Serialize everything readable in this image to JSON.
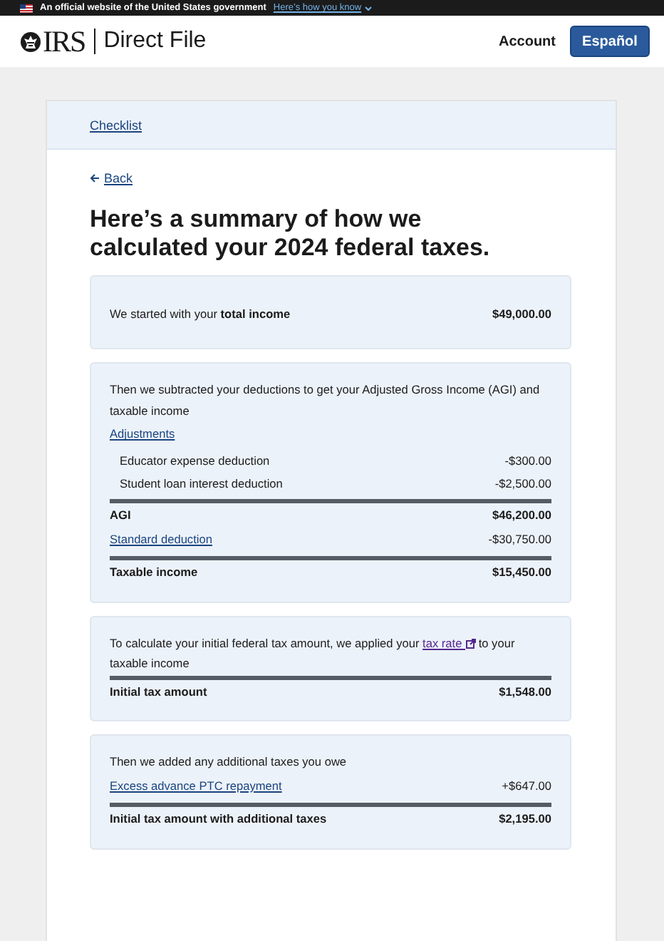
{
  "banner": {
    "text": "An official website of the United States government",
    "link": "Here’s how you know"
  },
  "header": {
    "logo": "IRS",
    "product": "Direct File",
    "nav": [
      "Account"
    ],
    "language_button": "Español"
  },
  "breadcrumb": "Checklist",
  "back_link": "Back",
  "heading": "Here’s a summary of how we calculated your 2024 federal taxes.",
  "sections": [
    {
      "rows": [
        {
          "kind": "summary",
          "label": "We started with your **total income**",
          "amount": "$49,000.00"
        }
      ]
    },
    {
      "rows": [
        {
          "kind": "text",
          "label": "Then we subtracted your deductions to get your Adjusted Gross Income (AGI) and taxable income"
        },
        {
          "kind": "link",
          "label": "Adjustments"
        },
        {
          "kind": "item",
          "label": "Educator expense deduction",
          "amount": "-$300.00"
        },
        {
          "kind": "item",
          "label": "Student loan interest deduction",
          "amount": "-$2,500.00"
        },
        {
          "kind": "total",
          "label": "AGI",
          "amount": "$46,200.00"
        },
        {
          "kind": "link",
          "label": "Standard deduction",
          "amount": "-$30,750.00"
        },
        {
          "kind": "total",
          "label": "Taxable income",
          "amount": "$15,450.00"
        }
      ]
    },
    {
      "rows": [
        {
          "kind": "text",
          "label": "To calculate your initial federal tax amount, we applied your",
          "link": "tax rate",
          "after": "to your taxable income"
        },
        {
          "kind": "total",
          "label": "Initial tax amount",
          "amount": "$1,548.00"
        }
      ]
    },
    {
      "rows": [
        {
          "kind": "text",
          "label": "Then we added any additional taxes you owe"
        },
        {
          "kind": "link",
          "label": "Excess advance PTC repayment",
          "amount": "+$647.00"
        },
        {
          "kind": "total",
          "label": "Initial tax amount with additional taxes",
          "amount": "$2,195.00"
        }
      ]
    }
  ]
}
